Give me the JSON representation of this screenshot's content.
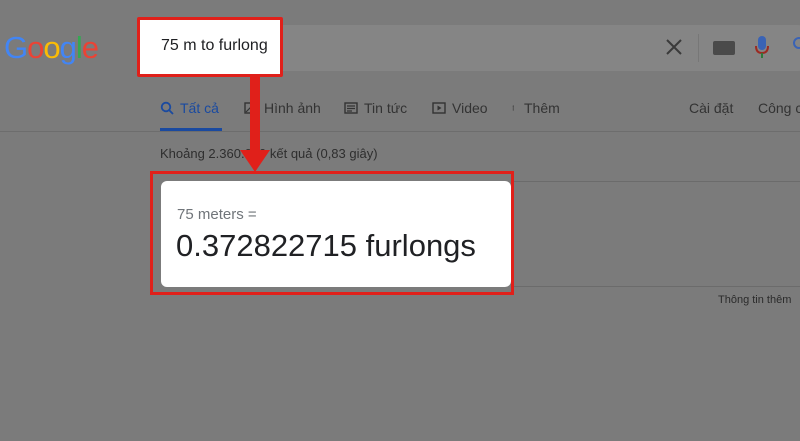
{
  "logo": {
    "letters": [
      "G",
      "o",
      "o",
      "g",
      "l",
      "e"
    ],
    "colors": [
      "#4285f4",
      "#ea4335",
      "#fbbc05",
      "#4285f4",
      "#34a853",
      "#ea4335"
    ]
  },
  "search": {
    "query": "75 m to furlong"
  },
  "tabs": [
    {
      "label": "Tất cả",
      "icon": "search-icon",
      "active": true
    },
    {
      "label": "Hình ảnh",
      "icon": "image-icon"
    },
    {
      "label": "Tin tức",
      "icon": "news-icon"
    },
    {
      "label": "Video",
      "icon": "video-icon"
    },
    {
      "label": "Thêm",
      "icon": "more-vert-icon"
    }
  ],
  "tools": {
    "settings": "Cài đặt",
    "tools": "Công c"
  },
  "stats": {
    "text": "Khoảng 2.360.000 kết quả (0,83 giây)"
  },
  "converter": {
    "from": "75 meters =",
    "result": "0.372822715 furlongs"
  },
  "footer": {
    "more_info": "Thông tin thêm"
  },
  "colors": {
    "highlight": "#e0201a",
    "active_tab": "#1a4aa0"
  }
}
